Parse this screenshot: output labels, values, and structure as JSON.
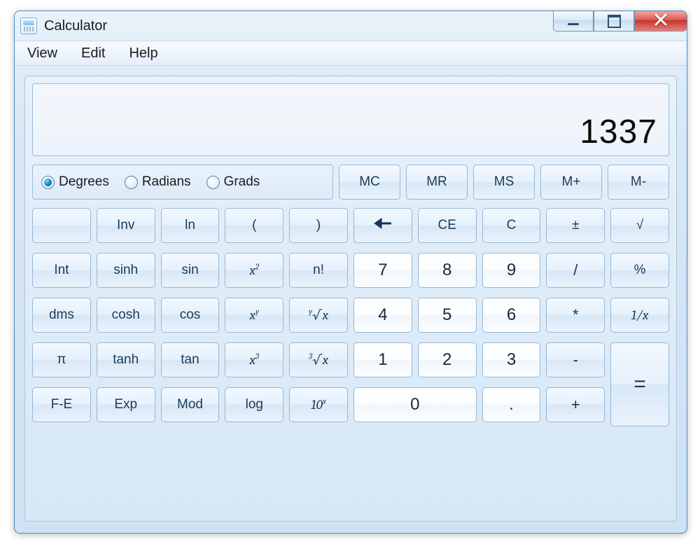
{
  "window": {
    "title": "Calculator"
  },
  "menu": {
    "view": "View",
    "edit": "Edit",
    "help": "Help"
  },
  "display": {
    "value": "1337"
  },
  "angle": {
    "selected": "degrees",
    "degrees": "Degrees",
    "radians": "Radians",
    "grads": "Grads"
  },
  "memory": {
    "mc": "MC",
    "mr": "MR",
    "ms": "MS",
    "mplus": "M+",
    "mminus": "M-"
  },
  "keys": {
    "blank": "",
    "inv": "Inv",
    "ln": "ln",
    "lparen": "(",
    "rparen": ")",
    "ce": "CE",
    "c": "C",
    "pm": "±",
    "sqrt": "√",
    "int": "Int",
    "sinh": "sinh",
    "sin": "sin",
    "nfact": "n!",
    "n7": "7",
    "n8": "8",
    "n9": "9",
    "div": "/",
    "pct": "%",
    "dms": "dms",
    "cosh": "cosh",
    "cos": "cos",
    "n4": "4",
    "n5": "5",
    "n6": "6",
    "mul": "*",
    "pi": "π",
    "tanh": "tanh",
    "tan": "tan",
    "n1": "1",
    "n2": "2",
    "n3": "3",
    "sub": "-",
    "eq": "=",
    "fe": "F-E",
    "exp": "Exp",
    "mod": "Mod",
    "log": "log",
    "n0": "0",
    "dot": ".",
    "add": "+"
  }
}
